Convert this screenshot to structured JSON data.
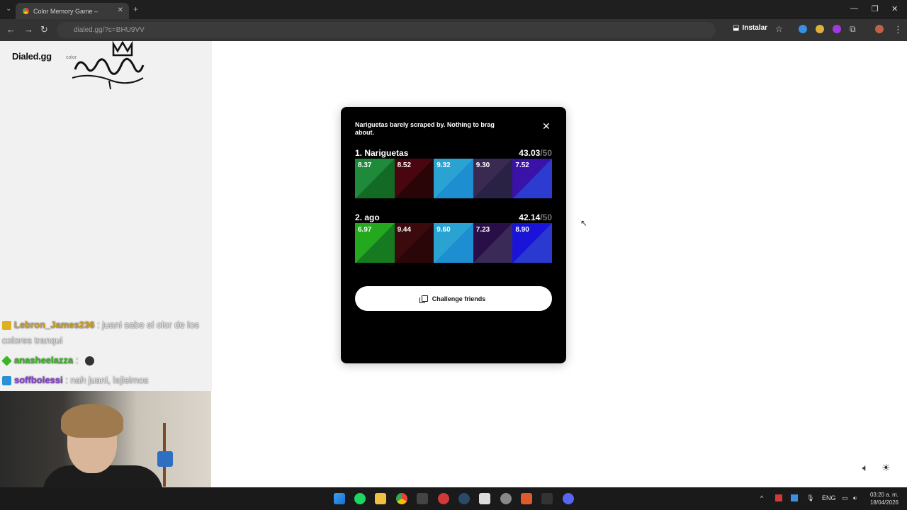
{
  "browser": {
    "tab_title": "Color Memory Game – ",
    "url": "dialed.gg/?c=BHU9VV",
    "install_label": "Instalar"
  },
  "overlay": {
    "brand": "Dialed.gg",
    "brand_sub": "color",
    "chat": [
      {
        "user": "Lebron_James236",
        "text": ": juani sabe el olor de los colores tranqui"
      },
      {
        "user": "anasheelazza",
        "text": ":"
      },
      {
        "user": "soffbolessi",
        "text": ": nah juani, lejisimos"
      }
    ]
  },
  "modal": {
    "message": "Nariguetas barely scraped by. Nothing to brag about.",
    "close_glyph": "✕",
    "players": [
      {
        "rank_name": "1. Nariguetas",
        "score": "43.03",
        "max": "/50",
        "swatches": [
          {
            "value": "8.37",
            "color": "#1f8a3a",
            "target": "#136a24"
          },
          {
            "value": "8.52",
            "color": "#4a0610",
            "target": "#2a0508"
          },
          {
            "value": "9.32",
            "color": "#2aa3d2",
            "target": "#1d8fd0"
          },
          {
            "value": "9.30",
            "color": "#3a2a52",
            "target": "#2a2244"
          },
          {
            "value": "7.52",
            "color": "#3a12a8",
            "target": "#2c3cd0"
          }
        ]
      },
      {
        "rank_name": "2. ago",
        "score": "42.14",
        "max": "/50",
        "swatches": [
          {
            "value": "6.97",
            "color": "#23a81e",
            "target": "#157a20"
          },
          {
            "value": "9.44",
            "color": "#3a0a0c",
            "target": "#2a0608"
          },
          {
            "value": "9.60",
            "color": "#2aa3d2",
            "target": "#1d8fd0"
          },
          {
            "value": "7.23",
            "color": "#2a0e48",
            "target": "#3a2a58"
          },
          {
            "value": "8.90",
            "color": "#1a14d8",
            "target": "#2a3ad0"
          }
        ]
      }
    ],
    "challenge_label": "Challenge friends"
  },
  "taskbar": {
    "lang": "ENG",
    "time": "03:20 a. m.",
    "date": "18/04/2026"
  }
}
